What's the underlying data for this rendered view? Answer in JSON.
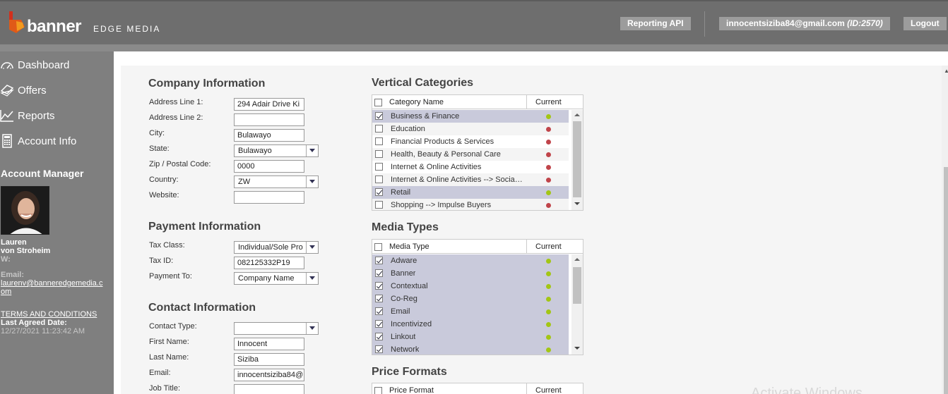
{
  "header": {
    "logo_main": "banner",
    "logo_sub": "EDGE MEDIA",
    "reporting_api": "Reporting API",
    "user_email": "innocentsiziba84@gmail.com",
    "user_id": "(ID:2570)",
    "logout": "Logout"
  },
  "sidebar": {
    "nav": [
      {
        "label": "Dashboard",
        "icon": "dashboard-icon"
      },
      {
        "label": "Offers",
        "icon": "offers-icon"
      },
      {
        "label": "Reports",
        "icon": "reports-icon"
      },
      {
        "label": "Account Info",
        "icon": "calculator-icon"
      }
    ],
    "account_manager_title": "Account Manager",
    "manager_first": "Lauren",
    "manager_last": "von Stroheim",
    "w_label": "W:",
    "email_label": "Email:",
    "email_line1": "laurenv@banneredgemedia.c",
    "email_line2": "om",
    "terms": "TERMS AND CONDITIONS",
    "last_agreed_label": "Last Agreed Date:",
    "last_agreed_value": "12/27/2021 11:23:42 AM"
  },
  "company": {
    "title": "Company Information",
    "address1_label": "Address Line 1:",
    "address1_value": "294 Adair Drive Ki",
    "address2_label": "Address Line 2:",
    "address2_value": "",
    "city_label": "City:",
    "city_value": "Bulawayo",
    "state_label": "State:",
    "state_value": "Bulawayo",
    "zip_label": "Zip / Postal Code:",
    "zip_value": "0000",
    "country_label": "Country:",
    "country_value": "ZW",
    "website_label": "Website:",
    "website_value": ""
  },
  "payment": {
    "title": "Payment Information",
    "tax_class_label": "Tax Class:",
    "tax_class_value": "Individual/Sole Pro",
    "tax_id_label": "Tax ID:",
    "tax_id_value": "082125332P19",
    "payment_to_label": "Payment To:",
    "payment_to_value": "Company Name"
  },
  "contact": {
    "title": "Contact Information",
    "type_label": "Contact Type:",
    "type_value": "",
    "first_label": "First Name:",
    "first_value": "Innocent",
    "last_label": "Last Name:",
    "last_value": "Siziba",
    "email_label": "Email:",
    "email_value": "innocentsiziba84@",
    "job_label": "Job Title:",
    "job_value": ""
  },
  "vertical": {
    "title": "Vertical Categories",
    "col_name": "Category Name",
    "col_current": "Current",
    "rows": [
      {
        "name": "Business & Finance",
        "checked": true,
        "status": "green"
      },
      {
        "name": "Education",
        "checked": false,
        "status": "red"
      },
      {
        "name": "Financial Products & Services",
        "checked": false,
        "status": "red"
      },
      {
        "name": "Health, Beauty & Personal Care",
        "checked": false,
        "status": "red"
      },
      {
        "name": "Internet & Online Activities",
        "checked": false,
        "status": "red"
      },
      {
        "name": "Internet & Online Activities --> Social Media",
        "checked": false,
        "status": "red"
      },
      {
        "name": "Retail",
        "checked": true,
        "status": "green"
      },
      {
        "name": "Shopping --> Impulse Buyers",
        "checked": false,
        "status": "red"
      }
    ]
  },
  "media": {
    "title": "Media Types",
    "col_name": "Media Type",
    "col_current": "Current",
    "rows": [
      {
        "name": "Adware",
        "checked": true,
        "status": "green"
      },
      {
        "name": "Banner",
        "checked": true,
        "status": "green"
      },
      {
        "name": "Contextual",
        "checked": true,
        "status": "green"
      },
      {
        "name": "Co-Reg",
        "checked": true,
        "status": "green"
      },
      {
        "name": "Email",
        "checked": true,
        "status": "green"
      },
      {
        "name": "Incentivized",
        "checked": true,
        "status": "green"
      },
      {
        "name": "Linkout",
        "checked": true,
        "status": "green"
      },
      {
        "name": "Network",
        "checked": true,
        "status": "green"
      }
    ]
  },
  "price": {
    "title": "Price Formats",
    "col_name": "Price Format",
    "col_current": "Current"
  },
  "watermark": "Activate Windows",
  "colors": {
    "header_bg": "#6e6e6e",
    "sidebar_bg": "#7f7f7f",
    "selected_row": "#c9cadb",
    "status_green": "#a3c614",
    "status_red": "#c0444a"
  }
}
